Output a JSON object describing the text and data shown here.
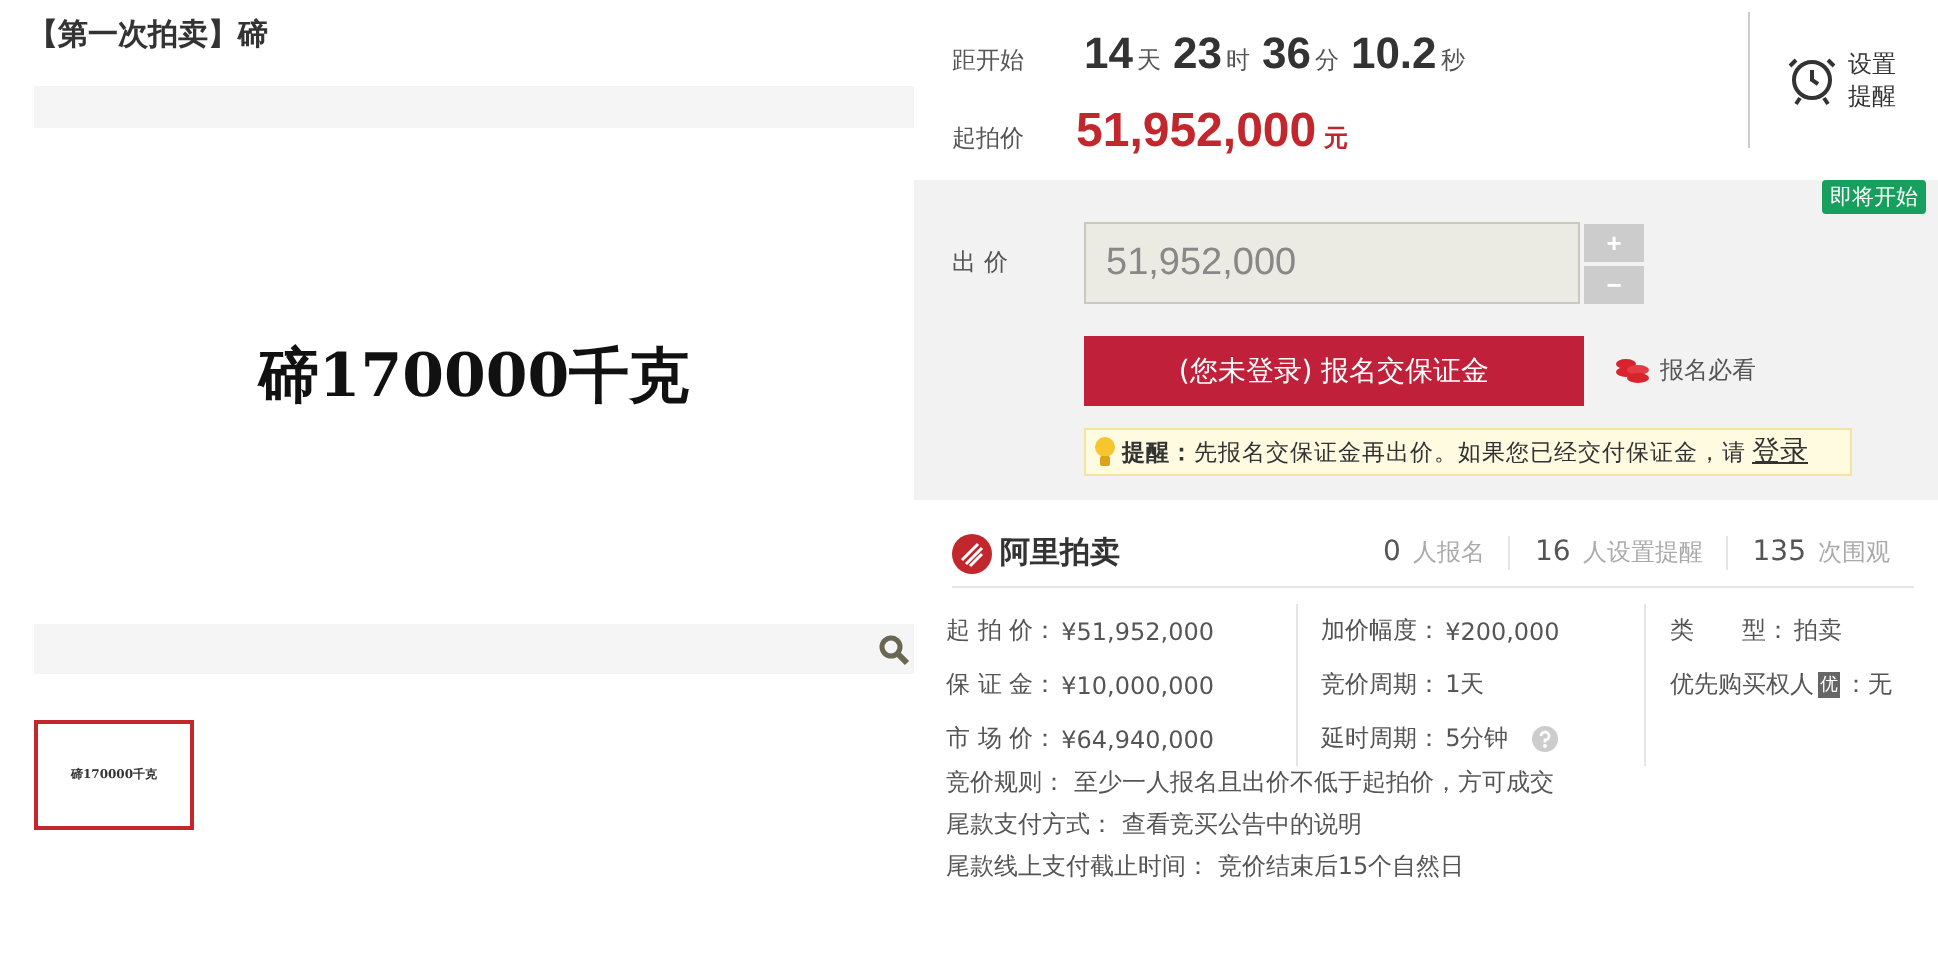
{
  "title": "【第一次拍卖】碲",
  "gallery": {
    "main_image_text": "碲170000千克",
    "thumbnails": [
      {
        "text": "碲170000千克",
        "selected": true
      }
    ]
  },
  "countdown": {
    "label": "距开始",
    "parts": [
      {
        "value": "14",
        "unit": "天"
      },
      {
        "value": "23",
        "unit": "时"
      },
      {
        "value": "36",
        "unit": "分"
      },
      {
        "value": "10.2",
        "unit": "秒"
      }
    ],
    "reminder": "设置提醒"
  },
  "start_price": {
    "label": "起拍价",
    "value": "51,952,000",
    "unit": "元"
  },
  "bid": {
    "badge": "即将开始",
    "label": "出 价",
    "value": "51,952,000",
    "disabled": true,
    "plus": "+",
    "minus": "−",
    "button": "(您未登录) 报名交保证金",
    "guide": "报名必看",
    "tip": "**提醒：**先报名交保证金再出价。如果您已经交付保证金，请",
    "tip_link": "登录"
  },
  "stats": {
    "brand": "阿里拍卖",
    "items": [
      {
        "count": "0",
        "label": "人报名"
      },
      {
        "count": "16",
        "label": "人设置提醒"
      },
      {
        "count": "135",
        "label": "次围观"
      }
    ]
  },
  "details": {
    "columns": [
      [
        {
          "label": "起 拍 价：",
          "value": "¥51,952,000"
        },
        {
          "label": "保 证 金：",
          "value": "¥10,000,000"
        },
        {
          "label": "市 场 价：",
          "value": "¥64,940,000"
        }
      ],
      [
        {
          "label": "加价幅度：",
          "value": "¥200,000"
        },
        {
          "label": "竞价周期：",
          "value": "1天"
        },
        {
          "label": "延时周期：",
          "value": "5分钟",
          "help": true
        }
      ],
      [
        {
          "label": "类　　型：",
          "value": "拍卖"
        },
        {
          "label": "优先购买权人",
          "mark": "优",
          "value": "：无"
        }
      ]
    ],
    "rules": [
      {
        "label": "竞价规则：",
        "value": "至少一人报名且出价不低于起拍价，方可成交"
      },
      {
        "label": "尾款支付方式：",
        "value": "查看竞买公告中的说明"
      },
      {
        "label": "尾款线上支付截止时间：",
        "value": "竞价结束后15个自然日"
      }
    ]
  }
}
